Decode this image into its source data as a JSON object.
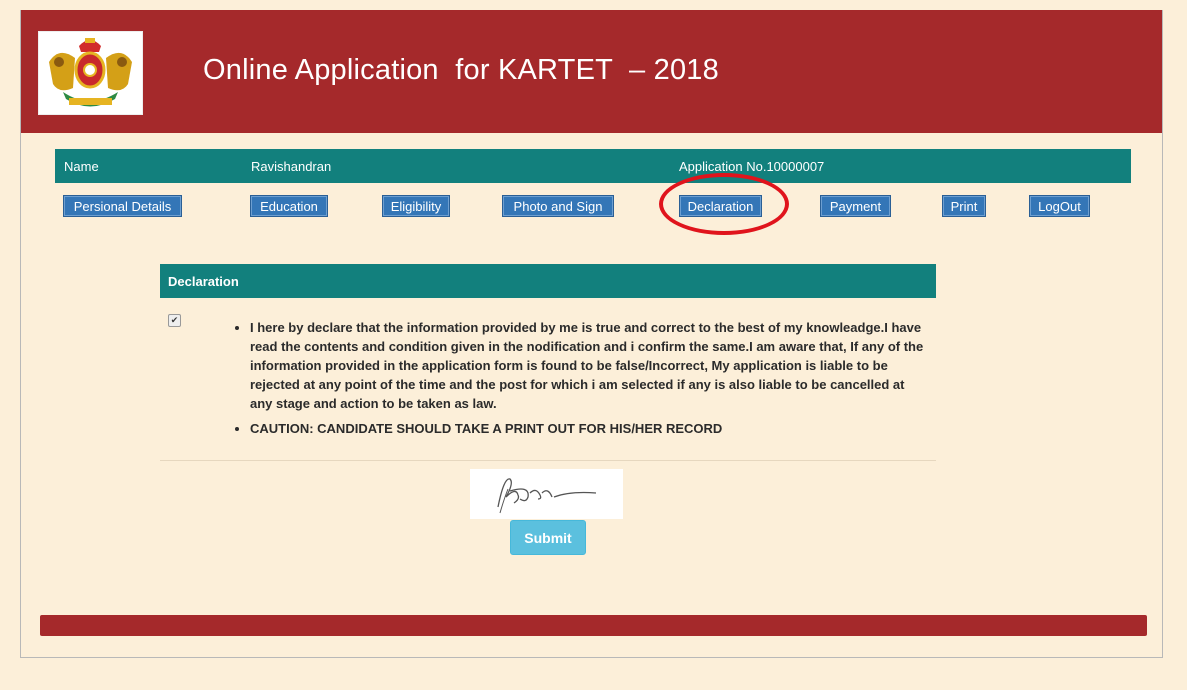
{
  "header": {
    "title": "Online Application  for KARTET  – 2018"
  },
  "info": {
    "name_label": "Name",
    "name_value": "Ravishandran",
    "application_no": "Application No.10000007"
  },
  "nav": [
    {
      "label": "Persional Details"
    },
    {
      "label": "Education"
    },
    {
      "label": "Eligibility"
    },
    {
      "label": "Photo and Sign"
    },
    {
      "label": "Declaration"
    },
    {
      "label": "Payment"
    },
    {
      "label": "Print"
    },
    {
      "label": "LogOut"
    }
  ],
  "declaration": {
    "heading": "Declaration",
    "checked": true,
    "text": "I here by declare that the information provided by me is true and correct to the best of my knowleadge.I have read the contents and condition given in the nodification and i confirm the same.I am aware that, If any of the information provided in the application form is found to be false/Incorrect, My application is liable to be rejected at any point of the time and the post for which i am selected if any is also liable to be cancelled at any stage and action to be taken as law.",
    "caution": "CAUTION: CANDIDATE SHOULD TAKE A PRINT OUT FOR HIS/HER RECORD"
  },
  "submit_label": "Submit",
  "colors": {
    "header": "#a5292b",
    "teal": "#12807d",
    "nav_button": "#3476b7",
    "submit": "#5bc0de",
    "highlight_circle": "#e0141c",
    "background": "#fcefd9"
  }
}
